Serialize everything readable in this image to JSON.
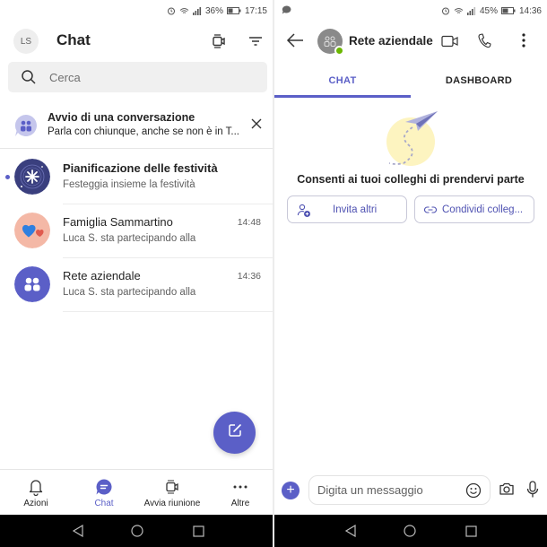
{
  "left_screen": {
    "status": {
      "signal": "36%",
      "time": "17:15"
    },
    "header": {
      "avatar_initials": "LS",
      "title": "Chat"
    },
    "search": {
      "placeholder": "Cerca"
    },
    "banner": {
      "title": "Avvio di una conversazione",
      "subtitle": "Parla con chiunque, anche se non è in T..."
    },
    "chats": [
      {
        "name": "Pianificazione delle festività",
        "preview": "Festeggia insieme la festività",
        "time": "",
        "unread": true
      },
      {
        "name": "Famiglia Sammartino",
        "preview": "Luca S. sta partecipando alla",
        "time": "14:48",
        "unread": false
      },
      {
        "name": "Rete aziendale",
        "preview": "Luca S. sta partecipando alla",
        "time": "14:36",
        "unread": false
      }
    ],
    "bottom_nav": [
      {
        "label": "Azioni",
        "icon": "bell-icon",
        "active": false
      },
      {
        "label": "Chat",
        "icon": "chat-icon",
        "active": true
      },
      {
        "label": "Avvia riunione",
        "icon": "meet-icon",
        "active": false
      },
      {
        "label": "Altre",
        "icon": "more-icon",
        "active": false
      }
    ]
  },
  "right_screen": {
    "status": {
      "signal": "45%",
      "time": "14:36"
    },
    "header": {
      "title": "Rete aziendale"
    },
    "tabs": [
      {
        "label": "CHAT",
        "active": true
      },
      {
        "label": "DASHBOARD",
        "active": false
      }
    ],
    "empty_state": {
      "title": "Consenti ai tuoi colleghi di prendervi parte",
      "invite_label": "Invita altri",
      "share_label": "Condividi colleg..."
    },
    "composer": {
      "placeholder": "Digita un messaggio"
    }
  },
  "colors": {
    "accent": "#5b5fc7",
    "presence": "#6bb700"
  }
}
